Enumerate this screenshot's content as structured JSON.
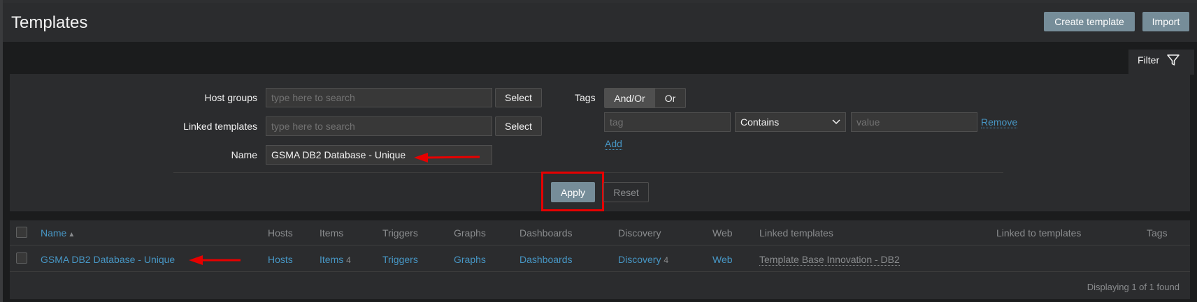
{
  "header": {
    "title": "Templates",
    "create_template_label": "Create template",
    "import_label": "Import"
  },
  "filter": {
    "tab_label": "Filter",
    "host_groups_label": "Host groups",
    "host_groups_placeholder": "type here to search",
    "linked_templates_label": "Linked templates",
    "linked_templates_placeholder": "type here to search",
    "name_label": "Name",
    "name_value": "GSMA DB2 Database - Unique",
    "select_label": "Select",
    "tags_label": "Tags",
    "tags_and_or": "And/Or",
    "tags_or": "Or",
    "tag_placeholder": "tag",
    "operator_value": "Contains",
    "value_placeholder": "value",
    "remove_label": "Remove",
    "add_label": "Add",
    "apply_label": "Apply",
    "reset_label": "Reset"
  },
  "table": {
    "columns": {
      "name": "Name",
      "name_sort_glyph": "▲",
      "hosts": "Hosts",
      "items": "Items",
      "triggers": "Triggers",
      "graphs": "Graphs",
      "dashboards": "Dashboards",
      "discovery": "Discovery",
      "web": "Web",
      "linked_templates": "Linked templates",
      "linked_to_templates": "Linked to templates",
      "tags": "Tags"
    },
    "rows": [
      {
        "name": "GSMA DB2 Database - Unique",
        "hosts": "Hosts",
        "items": "Items",
        "items_count": "4",
        "triggers": "Triggers",
        "graphs": "Graphs",
        "dashboards": "Dashboards",
        "discovery": "Discovery",
        "discovery_count": "4",
        "web": "Web",
        "linked_template": "Template Base Innovation - DB2"
      }
    ],
    "footer": "Displaying 1 of 1 found"
  },
  "colors": {
    "background": "#1b1c1d",
    "panel": "#2b2c2e",
    "primary_button": "#768d99",
    "link": "#4796c4",
    "annotation": "#e60000"
  }
}
